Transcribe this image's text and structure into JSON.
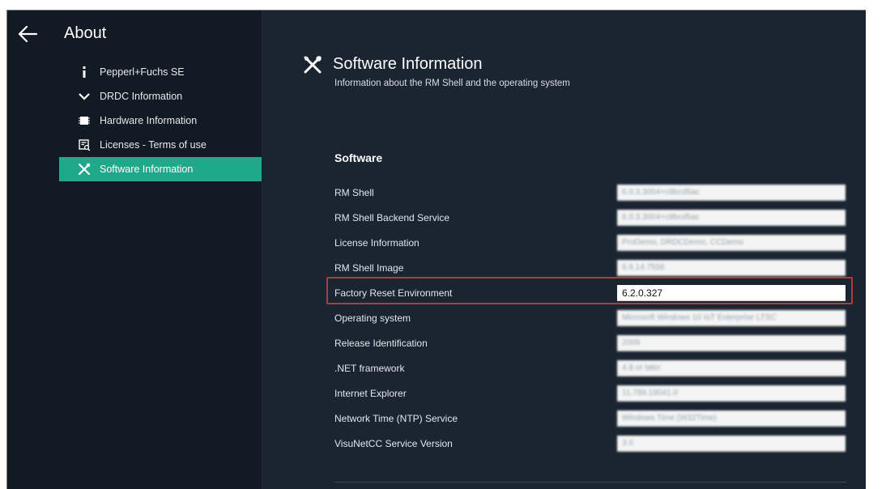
{
  "sidebar": {
    "title": "About",
    "items": [
      {
        "label": "Pepperl+Fuchs SE",
        "icon": "info-icon"
      },
      {
        "label": "DRDC Information",
        "icon": "chevron-down-icon"
      },
      {
        "label": "Hardware Information",
        "icon": "chip-icon"
      },
      {
        "label": "Licenses - Terms of use",
        "icon": "license-icon"
      },
      {
        "label": "Software Information",
        "icon": "tools-icon",
        "active": true
      }
    ]
  },
  "main": {
    "title": "Software Information",
    "subtitle": "Information about the RM Shell and the operating system",
    "section_title": "Software",
    "rows": [
      {
        "label": "RM Shell",
        "value": "6.0.3.3004+c8bcd5ac"
      },
      {
        "label": "RM Shell Backend Service",
        "value": "6.0.3.3004+c8bcd5ac"
      },
      {
        "label": "License Information",
        "value": "ProDemo, DRDCDemo, CCDemo"
      },
      {
        "label": "RM Shell Image",
        "value": "6.6.14.7556"
      },
      {
        "label": "Factory Reset Environment",
        "value": "6.2.0.327"
      },
      {
        "label": "Operating system",
        "value": "Microsoft Windows 10 IoT Enterprise LTSC"
      },
      {
        "label": "Release Identification",
        "value": "2009"
      },
      {
        "label": ".NET framework",
        "value": "4.8 or later"
      },
      {
        "label": "Internet Explorer",
        "value": "11.789.19041.0"
      },
      {
        "label": "Network Time (NTP) Service",
        "value": "Windows Time (W32Time)"
      },
      {
        "label": "VisuNetCC Service Version",
        "value": "3.0"
      }
    ]
  },
  "colors": {
    "sidebar_bg": "#121a24",
    "main_bg": "#1b2431",
    "accent": "#1fa88a",
    "highlight": "#b33a3a"
  }
}
